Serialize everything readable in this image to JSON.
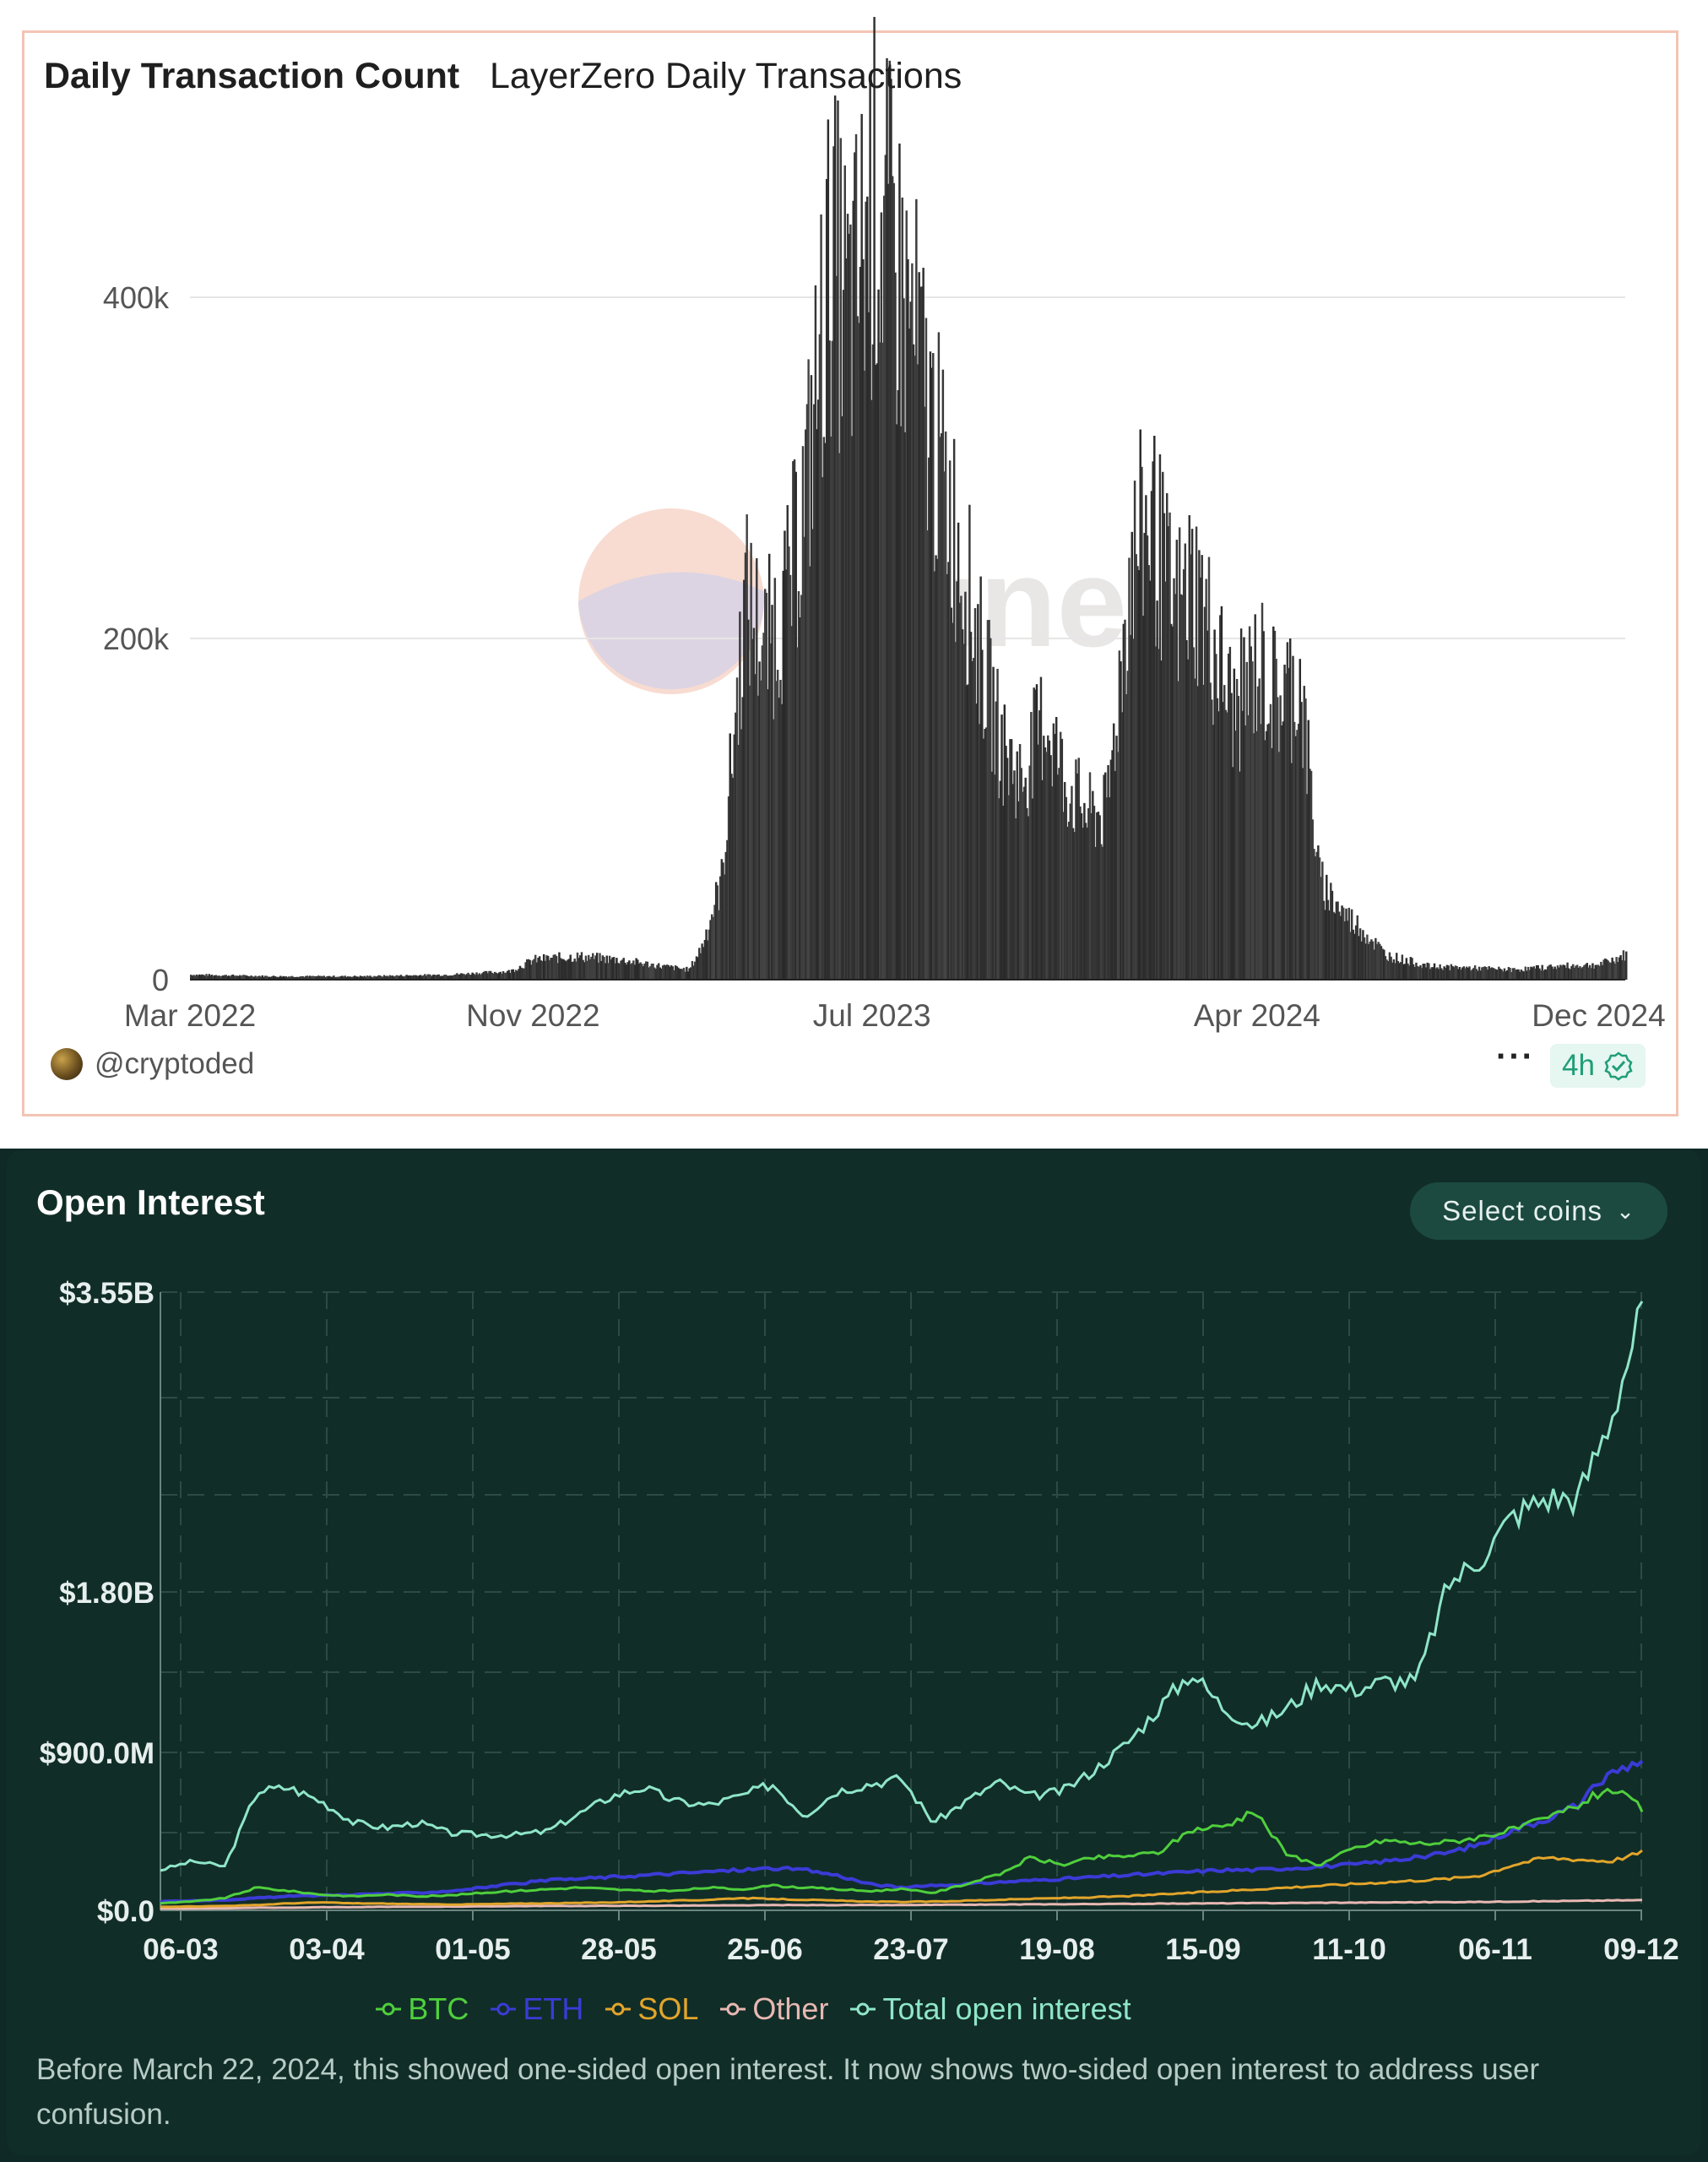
{
  "panels": {
    "transactions": {
      "title": "Daily Transaction Count",
      "subtitle": "LayerZero Daily Transactions",
      "author": "@cryptoded",
      "more_label": "···",
      "refresh_label": "4h",
      "watermark": "Dune"
    },
    "open_interest": {
      "title": "Open Interest",
      "select_label": "Select coins",
      "footnote": "Before March 22, 2024, this showed one-sided open interest. It now shows two-sided open interest to address user confusion."
    }
  },
  "colors": {
    "bar": "#3a3a3a",
    "btc": "#4fcf3c",
    "eth": "#3b3bd6",
    "sol": "#e2a52b",
    "other": "#e8b8b2",
    "total": "#8fe6c8",
    "panel_bg": "#112d28"
  },
  "chart_data": [
    {
      "type": "bar",
      "title": "Daily Transaction Count",
      "subtitle": "LayerZero Daily Transactions",
      "x_ticks": [
        "Mar 2022",
        "Nov 2022",
        "Jul 2023",
        "Apr 2024",
        "Dec 2024"
      ],
      "y_ticks": [
        "0",
        "200k",
        "400k"
      ],
      "ylim": [
        0,
        500000
      ],
      "xlim": [
        "2022-03-01",
        "2024-12-20"
      ],
      "grid": true,
      "series": [
        {
          "values_description_free_samples": true,
          "x": [
            "2022-03-01",
            "2022-05-01",
            "2022-07-01",
            "2022-09-01",
            "2022-10-15",
            "2022-11-01",
            "2022-12-01",
            "2023-01-01",
            "2023-02-01",
            "2023-02-20",
            "2023-03-01",
            "2023-03-15",
            "2023-04-01",
            "2023-04-15",
            "2023-05-01",
            "2023-05-15",
            "2023-06-01",
            "2023-06-15",
            "2023-07-01",
            "2023-07-15",
            "2023-08-01",
            "2023-08-15",
            "2023-09-01",
            "2023-09-15",
            "2023-10-01",
            "2023-10-15",
            "2023-11-01",
            "2023-11-15",
            "2023-12-01",
            "2023-12-15",
            "2024-01-01",
            "2024-01-15",
            "2024-02-01",
            "2024-02-15",
            "2024-03-01",
            "2024-03-15",
            "2024-04-01",
            "2024-04-15",
            "2024-05-01",
            "2024-05-15",
            "2024-06-01",
            "2024-06-15",
            "2024-07-01",
            "2024-08-01",
            "2024-09-01",
            "2024-10-01",
            "2024-11-01",
            "2024-12-01",
            "2024-12-20"
          ],
          "y": [
            3000,
            2000,
            2000,
            3000,
            5000,
            12000,
            14000,
            12000,
            8000,
            6000,
            20000,
            60000,
            230000,
            200000,
            230000,
            300000,
            440000,
            400000,
            470000,
            440000,
            380000,
            320000,
            260000,
            200000,
            140000,
            120000,
            160000,
            120000,
            100000,
            100000,
            250000,
            280000,
            220000,
            240000,
            200000,
            160000,
            190000,
            170000,
            180000,
            60000,
            40000,
            30000,
            15000,
            8000,
            7000,
            6000,
            8000,
            9000,
            15000
          ]
        }
      ]
    },
    {
      "type": "line",
      "title": "Open Interest",
      "x_ticks": [
        "06-03",
        "03-04",
        "01-05",
        "28-05",
        "25-06",
        "23-07",
        "19-08",
        "15-09",
        "11-10",
        "06-11",
        "09-12"
      ],
      "y_ticks": [
        "$0.0",
        "$900.0M",
        "$1.80B",
        "$3.55B"
      ],
      "ylim": [
        0,
        3550000000
      ],
      "grid": true,
      "legend_position": "bottom",
      "series": [
        {
          "name": "BTC",
          "color": "#4fcf3c",
          "y": [
            40000000,
            50000000,
            70000000,
            130000000,
            110000000,
            90000000,
            80000000,
            90000000,
            80000000,
            85000000,
            100000000,
            110000000,
            120000000,
            130000000,
            120000000,
            110000000,
            110000000,
            130000000,
            120000000,
            140000000,
            130000000,
            120000000,
            110000000,
            120000000,
            100000000,
            150000000,
            200000000,
            300000000,
            260000000,
            300000000,
            310000000,
            330000000,
            460000000,
            480000000,
            560000000,
            310000000,
            260000000,
            350000000,
            400000000,
            380000000,
            390000000,
            420000000,
            460000000,
            520000000,
            600000000,
            700000000,
            580000000
          ]
        },
        {
          "name": "ETH",
          "color": "#3b3bd6",
          "y": [
            50000000,
            55000000,
            60000000,
            70000000,
            80000000,
            85000000,
            90000000,
            95000000,
            100000000,
            110000000,
            130000000,
            150000000,
            170000000,
            180000000,
            190000000,
            200000000,
            210000000,
            220000000,
            230000000,
            240000000,
            230000000,
            200000000,
            150000000,
            130000000,
            140000000,
            150000000,
            160000000,
            170000000,
            180000000,
            190000000,
            200000000,
            210000000,
            220000000,
            230000000,
            230000000,
            240000000,
            250000000,
            260000000,
            280000000,
            300000000,
            330000000,
            380000000,
            460000000,
            520000000,
            600000000,
            780000000,
            860000000
          ]
        },
        {
          "name": "SOL",
          "color": "#e2a52b",
          "y": [
            20000000,
            22000000,
            25000000,
            30000000,
            40000000,
            45000000,
            40000000,
            38000000,
            35000000,
            33000000,
            35000000,
            38000000,
            40000000,
            42000000,
            45000000,
            50000000,
            55000000,
            60000000,
            70000000,
            65000000,
            60000000,
            55000000,
            50000000,
            48000000,
            50000000,
            55000000,
            60000000,
            65000000,
            70000000,
            75000000,
            80000000,
            90000000,
            100000000,
            110000000,
            120000000,
            130000000,
            140000000,
            150000000,
            160000000,
            170000000,
            180000000,
            200000000,
            260000000,
            300000000,
            290000000,
            280000000,
            330000000
          ]
        },
        {
          "name": "Other",
          "color": "#e8b8b2",
          "y": [
            10000000,
            10000000,
            12000000,
            15000000,
            15000000,
            18000000,
            18000000,
            20000000,
            20000000,
            22000000,
            22000000,
            24000000,
            25000000,
            25000000,
            26000000,
            26000000,
            27000000,
            28000000,
            28000000,
            30000000,
            30000000,
            30000000,
            30000000,
            30000000,
            31000000,
            32000000,
            33000000,
            34000000,
            35000000,
            36000000,
            37000000,
            38000000,
            39000000,
            40000000,
            41000000,
            42000000,
            43000000,
            44000000,
            45000000,
            46000000,
            47000000,
            48000000,
            50000000,
            52000000,
            54000000,
            56000000,
            58000000
          ]
        },
        {
          "name": "Total open interest",
          "color": "#8fe6c8",
          "y": [
            230000000,
            280000000,
            250000000,
            680000000,
            700000000,
            620000000,
            500000000,
            470000000,
            500000000,
            440000000,
            430000000,
            430000000,
            450000000,
            550000000,
            650000000,
            700000000,
            620000000,
            600000000,
            650000000,
            720000000,
            540000000,
            680000000,
            720000000,
            750000000,
            500000000,
            620000000,
            730000000,
            650000000,
            680000000,
            800000000,
            950000000,
            1150000000,
            1350000000,
            1150000000,
            1050000000,
            1150000000,
            1300000000,
            1250000000,
            1300000000,
            1300000000,
            1850000000,
            2000000000,
            2250000000,
            2350000000,
            2350000000,
            2800000000,
            3450000000
          ]
        }
      ]
    }
  ]
}
